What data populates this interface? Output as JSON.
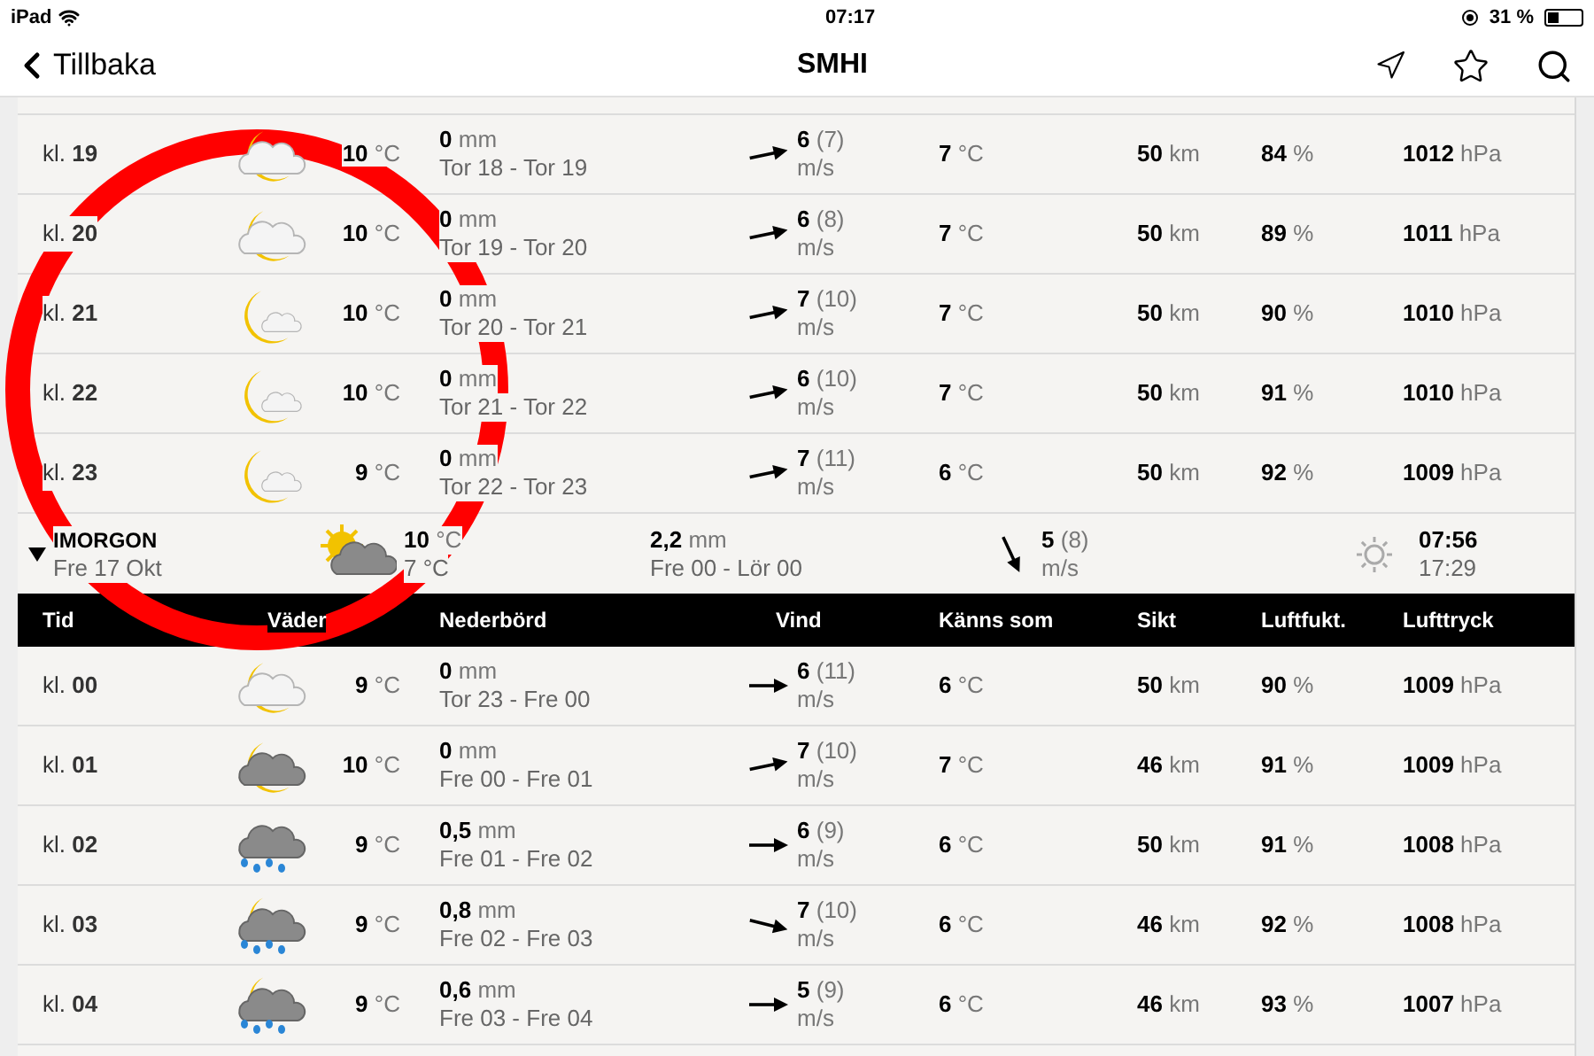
{
  "status_bar": {
    "device": "iPad",
    "time": "07:17",
    "battery": "31 %"
  },
  "nav": {
    "back": "Tillbaka",
    "title": "SMHI"
  },
  "today_rows": [
    {
      "time": "kl. **19**",
      "weather": {
        "kind": "cloud-moon",
        "temp": "10",
        "unit": "°C"
      },
      "precip": "0",
      "precip_unit": "mm",
      "period": "Tor 18 - Tor 19",
      "wind": {
        "kind": "ene",
        "speed": "6",
        "gust": "(7)",
        "unit": "m/s"
      },
      "feels": "7",
      "feels_unit": "°C",
      "visibility": "50",
      "visibility_unit": "km",
      "humidity": "84",
      "humidity_unit": "%",
      "pressure": "1012",
      "pressure_unit": "hPa"
    },
    {
      "time": "kl. **20**",
      "weather": {
        "kind": "cloud-moon",
        "temp": "10",
        "unit": "°C"
      },
      "precip": "0",
      "precip_unit": "mm",
      "period": "Tor 19 - Tor 20",
      "wind": {
        "kind": "ene",
        "speed": "6",
        "gust": "(8)",
        "unit": "m/s"
      },
      "feels": "7",
      "feels_unit": "°C",
      "visibility": "50",
      "visibility_unit": "km",
      "humidity": "89",
      "humidity_unit": "%",
      "pressure": "1011",
      "pressure_unit": "hPa"
    },
    {
      "time": "kl. **21**",
      "weather": {
        "kind": "moon-cloud",
        "temp": "10",
        "unit": "°C"
      },
      "precip": "0",
      "precip_unit": "mm",
      "period": "Tor 20 - Tor 21",
      "wind": {
        "kind": "ene",
        "speed": "7",
        "gust": "(10)",
        "unit": "m/s"
      },
      "feels": "7",
      "feels_unit": "°C",
      "visibility": "50",
      "visibility_unit": "km",
      "humidity": "90",
      "humidity_unit": "%",
      "pressure": "1010",
      "pressure_unit": "hPa"
    },
    {
      "time": "kl. **22**",
      "weather": {
        "kind": "moon-cloud",
        "temp": "10",
        "unit": "°C"
      },
      "precip": "0",
      "precip_unit": "mm",
      "period": "Tor 21 - Tor 22",
      "wind": {
        "kind": "ene",
        "speed": "6",
        "gust": "(10)",
        "unit": "m/s"
      },
      "feels": "7",
      "feels_unit": "°C",
      "visibility": "50",
      "visibility_unit": "km",
      "humidity": "91",
      "humidity_unit": "%",
      "pressure": "1010",
      "pressure_unit": "hPa"
    },
    {
      "time": "kl. **23**",
      "weather": {
        "kind": "moon-cloud",
        "temp": "9",
        "unit": "°C"
      },
      "precip": "0",
      "precip_unit": "mm",
      "period": "Tor 22 - Tor 23",
      "wind": {
        "kind": "ene",
        "speed": "7",
        "gust": "(11)",
        "unit": "m/s"
      },
      "feels": "6",
      "feels_unit": "°C",
      "visibility": "50",
      "visibility_unit": "km",
      "humidity": "92",
      "humidity_unit": "%",
      "pressure": "1009",
      "pressure_unit": "hPa"
    }
  ],
  "day_summary": {
    "expanded": true,
    "day": "IMORGON",
    "date": "Fre 17 Okt",
    "weather": {
      "kind": "sun-cloud",
      "temp": "10",
      "unit": "°C",
      "min": "7",
      "min_unit": "°C"
    },
    "precip": "2,2",
    "precip_unit": "mm",
    "period": "Fre 00 - Lör 00",
    "wind": {
      "kind": "sse",
      "speed": "5",
      "gust": "(8)",
      "unit": "m/s"
    },
    "sunrise": "07:56",
    "sunset": "17:29"
  },
  "columns": [
    "Tid",
    "Väder",
    "Nederbörd",
    "Vind",
    "Känns som",
    "Sikt",
    "Luftfukt.",
    "Lufttryck"
  ],
  "tomorrow_rows": [
    {
      "time": "kl. **00**",
      "weather": {
        "kind": "cloud-moon",
        "temp": "9",
        "unit": "°C"
      },
      "precip": "0",
      "precip_unit": "mm",
      "period": "Tor 23 - Fre 00",
      "wind": {
        "kind": "east",
        "speed": "6",
        "gust": "(11)",
        "unit": "m/s"
      },
      "feels": "6",
      "feels_unit": "°C",
      "visibility": "50",
      "visibility_unit": "km",
      "humidity": "90",
      "humidity_unit": "%",
      "pressure": "1009",
      "pressure_unit": "hPa"
    },
    {
      "time": "kl. **01**",
      "weather": {
        "kind": "dark-cloud-moon",
        "temp": "10",
        "unit": "°C"
      },
      "precip": "0",
      "precip_unit": "mm",
      "period": "Fre 00 - Fre 01",
      "wind": {
        "kind": "ene",
        "speed": "7",
        "gust": "(10)",
        "unit": "m/s"
      },
      "feels": "7",
      "feels_unit": "°C",
      "visibility": "46",
      "visibility_unit": "km",
      "humidity": "91",
      "humidity_unit": "%",
      "pressure": "1009",
      "pressure_unit": "hPa"
    },
    {
      "time": "kl. **02**",
      "weather": {
        "kind": "rain",
        "temp": "9",
        "unit": "°C"
      },
      "precip": "0,5",
      "precip_unit": "mm",
      "period": "Fre 01 - Fre 02",
      "wind": {
        "kind": "east",
        "speed": "6",
        "gust": "(9)",
        "unit": "m/s"
      },
      "feels": "6",
      "feels_unit": "°C",
      "visibility": "50",
      "visibility_unit": "km",
      "humidity": "91",
      "humidity_unit": "%",
      "pressure": "1008",
      "pressure_unit": "hPa"
    },
    {
      "time": "kl. **03**",
      "weather": {
        "kind": "rain-moon",
        "temp": "9",
        "unit": "°C"
      },
      "precip": "0,8",
      "precip_unit": "mm",
      "period": "Fre 02 - Fre 03",
      "wind": {
        "kind": "ese",
        "speed": "7",
        "gust": "(10)",
        "unit": "m/s"
      },
      "feels": "6",
      "feels_unit": "°C",
      "visibility": "46",
      "visibility_unit": "km",
      "humidity": "92",
      "humidity_unit": "%",
      "pressure": "1008",
      "pressure_unit": "hPa"
    },
    {
      "time": "kl. **04**",
      "weather": {
        "kind": "rain-moon",
        "temp": "9",
        "unit": "°C"
      },
      "precip": "0,6",
      "precip_unit": "mm",
      "period": "Fre 03 - Fre 04",
      "wind": {
        "kind": "east",
        "speed": "5",
        "gust": "(9)",
        "unit": "m/s"
      },
      "feels": "6",
      "feels_unit": "°C",
      "visibility": "46",
      "visibility_unit": "km",
      "humidity": "93",
      "humidity_unit": "%",
      "pressure": "1007",
      "pressure_unit": "hPa"
    }
  ]
}
